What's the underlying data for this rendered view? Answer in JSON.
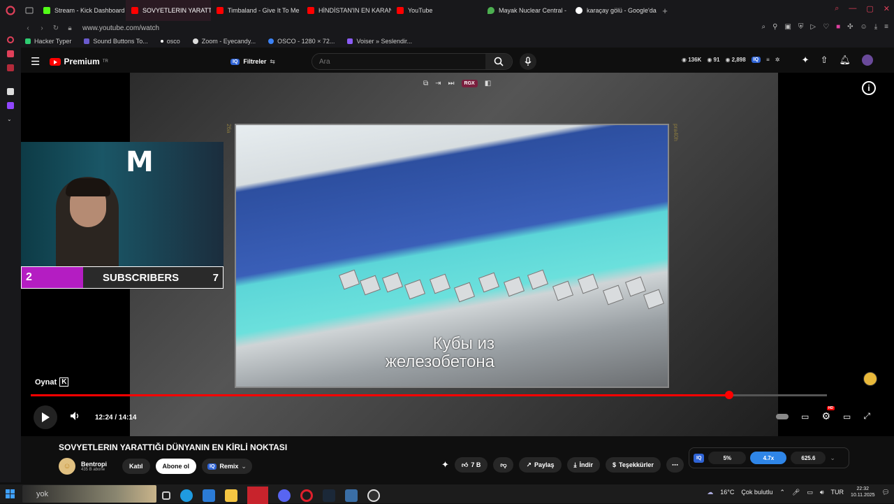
{
  "tabs": [
    {
      "label": "Stream - Kick Dashboard",
      "color": "#53fc18",
      "active": false
    },
    {
      "label": "SOVYETLERIN YARATTIĞ",
      "color": "#ff0000",
      "active": true
    },
    {
      "label": "Timbaland - Give It To Me",
      "color": "#ff0000",
      "active": false
    },
    {
      "label": "HİNDİSTAN'IN EN KARAN",
      "color": "#ff0000",
      "active": false
    },
    {
      "label": "YouTube",
      "color": "#ff0000",
      "active": false
    },
    {
      "label": "Mayak Nuclear Central - ",
      "color": "#4caf50",
      "active": false
    },
    {
      "label": "karaçay gölü - Google'da",
      "color": "#4285f4",
      "active": false
    }
  ],
  "address": {
    "url": "www.youtube.com/watch"
  },
  "bookmarks": [
    {
      "label": "Hacker Typer",
      "color": "#2ecc71"
    },
    {
      "label": "Sound Buttons To...",
      "color": "#6a5acd"
    },
    {
      "label": "osco",
      "color": "#ffffff"
    },
    {
      "label": "Zoom - Eyecandy...",
      "color": "#dddddd"
    },
    {
      "label": "OSCO - 1280 × 72...",
      "color": "#3b82f6"
    },
    {
      "label": "Voiser » Seslendir...",
      "color": "#8b5cf6"
    }
  ],
  "youtube": {
    "brand": "Premium",
    "brand_region": "TR",
    "filters_badge": "IQ",
    "filters_label": "Filtreler",
    "search_placeholder": "Ara",
    "stats": {
      "views": "136K",
      "likes": "91",
      "comments": "2,898"
    }
  },
  "player": {
    "caption_line1": "Кубы из",
    "caption_line2": "железобетона",
    "film_left": "26a",
    "film_right": "pra40h",
    "rgx_label": "RGX",
    "tooltip_label": "Oynat",
    "tooltip_key": "K",
    "time_current": "12:24",
    "time_total": "14:14",
    "progress": 0.877,
    "hd_badge": "HD"
  },
  "overlay": {
    "sub_count": "2",
    "sub_label": "SUBSCRIBERS",
    "sub_goal": "7"
  },
  "video": {
    "title": "SOVYETLERIN YARATTIĞI DÜNYANIN EN KİRLİ NOKTASI",
    "channel": "Bentropi",
    "subscribers": "435 B abone",
    "join_label": "Katıl",
    "subscribe_label": "Abone ol",
    "remix_label": "Remix",
    "like_count": "7 B",
    "share_label": "Paylaş",
    "download_label": "İndir",
    "thanks_label": "Teşekkürler"
  },
  "iq_panel": {
    "badge": "IQ",
    "speed_a": "5%",
    "speed_b": "4.7x",
    "value": "625.6"
  },
  "taskbar": {
    "search_text": "yok",
    "weather_temp": "16°C",
    "weather_text": "Çok bulutlu",
    "lang": "TUR",
    "time": "22:32",
    "date": "10.11.2025"
  }
}
